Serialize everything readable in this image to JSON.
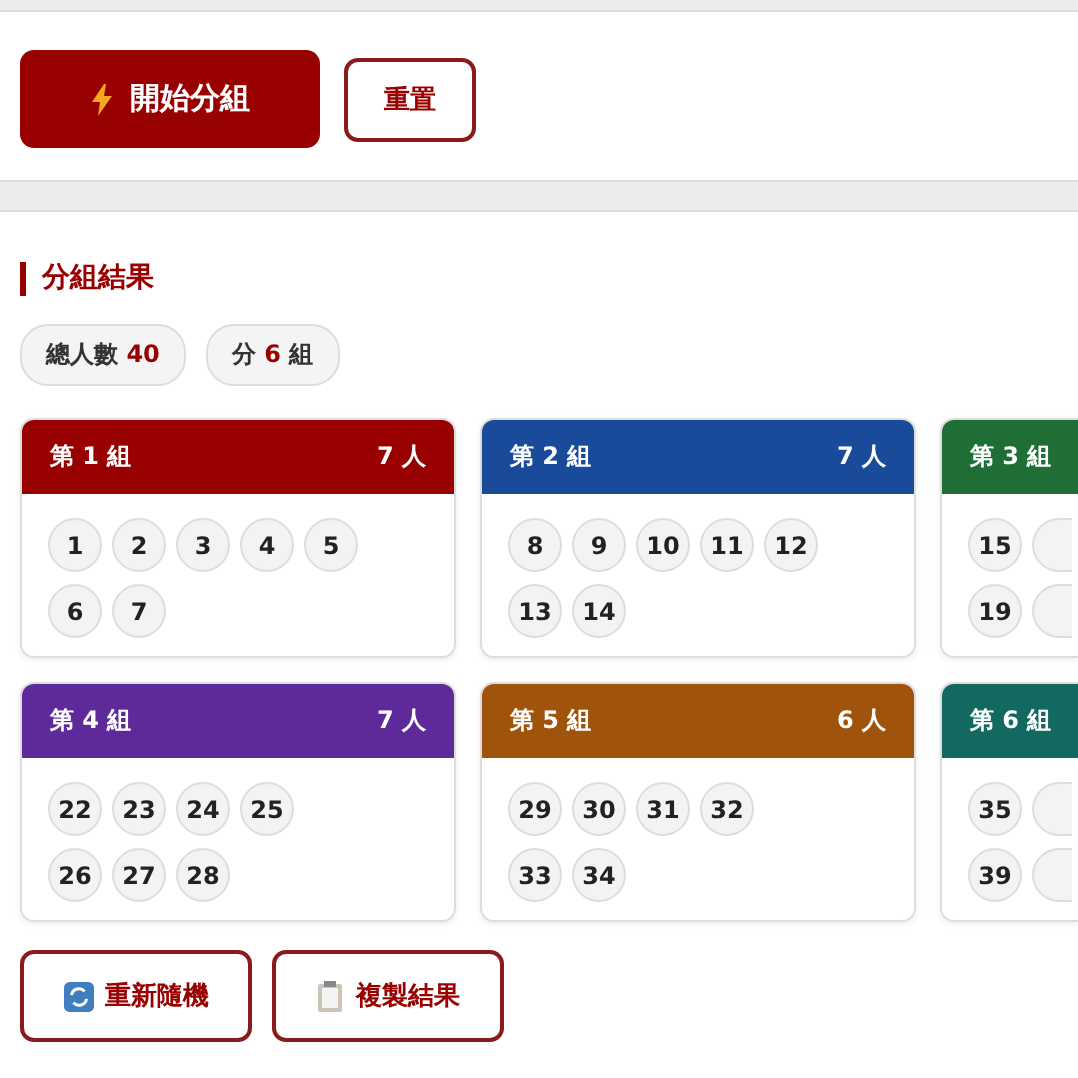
{
  "actions": {
    "start": {
      "label": "開始分組"
    },
    "reset": {
      "label": "重置"
    }
  },
  "results": {
    "title": "分組結果",
    "stats": [
      {
        "label": "總人數",
        "value": "40"
      },
      {
        "label": "分",
        "value": "6",
        "suffix": "組"
      }
    ],
    "groups": [
      {
        "name": "第 1 組",
        "count": "7 人",
        "color": "#990000",
        "cut": false,
        "rows": [
          [
            "1",
            "2",
            "3",
            "4",
            "5"
          ],
          [
            "6",
            "7"
          ]
        ]
      },
      {
        "name": "第 2 組",
        "count": "7 人",
        "color": "#1a4a9a",
        "cut": false,
        "rows": [
          [
            "8",
            "9",
            "10",
            "11",
            "12"
          ],
          [
            "13",
            "14"
          ]
        ]
      },
      {
        "name": "第 3 組",
        "color": "#1f6e35",
        "cut": true,
        "rows": [
          [
            "15"
          ],
          [
            "19"
          ]
        ]
      },
      {
        "name": "第 4 組",
        "count": "7 人",
        "color": "#5e2a9a",
        "cut": false,
        "rows": [
          [
            "22",
            "23",
            "24",
            "25"
          ],
          [
            "26",
            "27",
            "28"
          ]
        ]
      },
      {
        "name": "第 5 組",
        "count": "6 人",
        "color": "#a0530a",
        "cut": false,
        "rows": [
          [
            "29",
            "30",
            "31",
            "32"
          ],
          [
            "33",
            "34"
          ]
        ]
      },
      {
        "name": "第 6 組",
        "color": "#11695f",
        "cut": true,
        "rows": [
          [
            "35"
          ],
          [
            "39"
          ]
        ]
      }
    ],
    "buttons": [
      {
        "label": "重新隨機"
      },
      {
        "label": "複製結果"
      }
    ]
  }
}
